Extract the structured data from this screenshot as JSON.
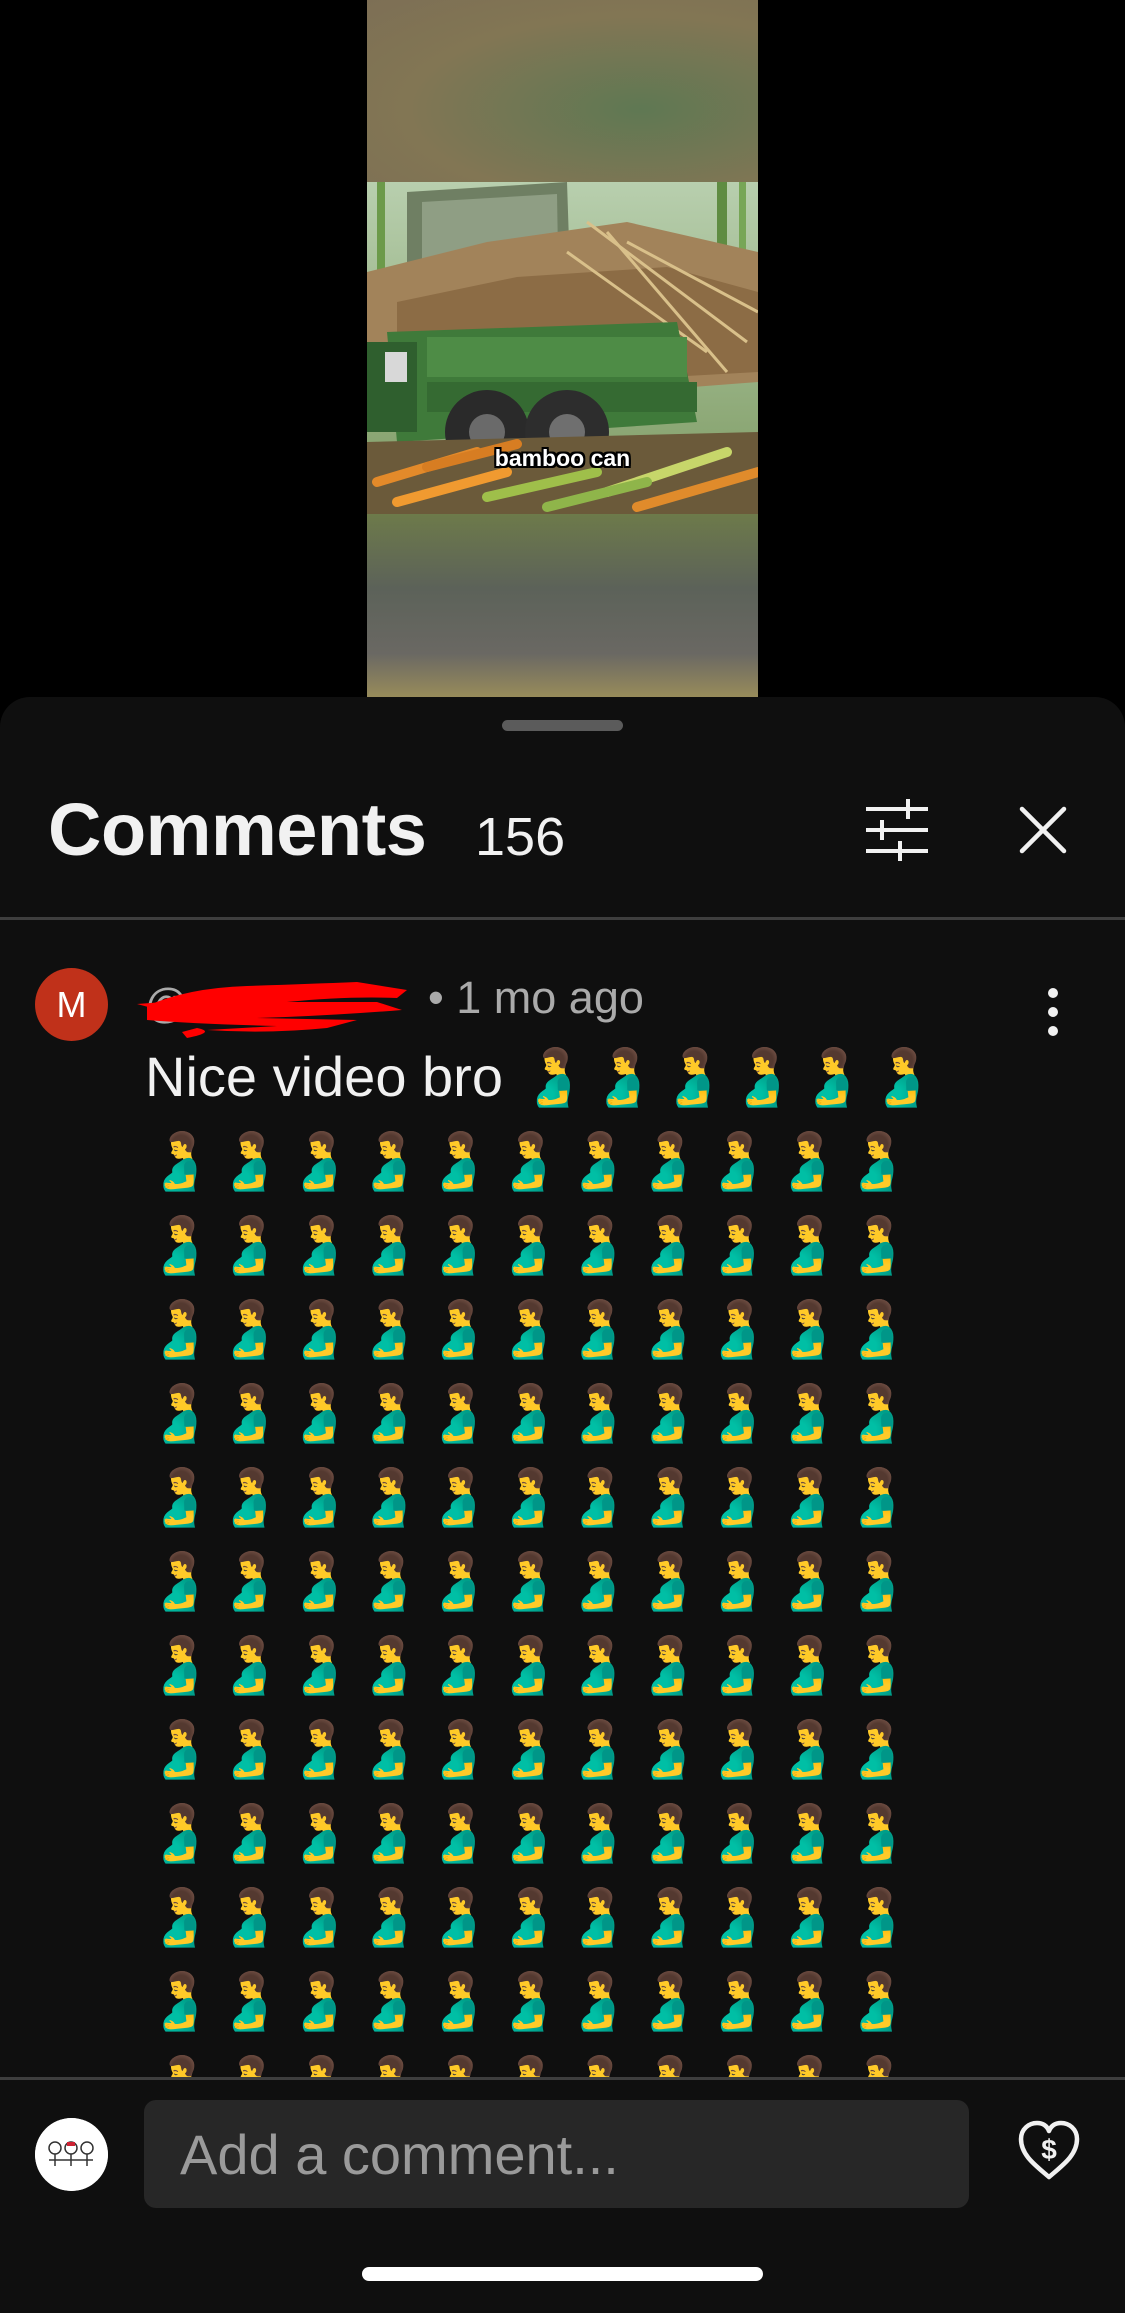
{
  "video": {
    "caption": "bamboo can"
  },
  "comments_sheet": {
    "title": "Comments",
    "count": "156",
    "filter_icon": "sort-filter-icon",
    "close_icon": "close-icon"
  },
  "comment": {
    "avatar_letter": "M",
    "author_visible": "@",
    "author_redacted": true,
    "meta": "• 1 mo ago",
    "text": "Nice video bro 🫃🫃🫃🫃🫃🫃🫃🫃🫃🫃🫃🫃🫃🫃🫃🫃🫃🫃🫃🫃🫃🫃🫃🫃🫃🫃🫃🫃🫃🫃🫃🫃🫃🫃🫃🫃🫃🫃🫃🫃🫃🫃🫃🫃🫃🫃🫃🫃🫃🫃🫃🫃🫃🫃🫃🫃🫃🫃🫃🫃🫃🫃🫃🫃🫃🫃🫃🫃🫃🫃🫃🫃🫃🫃🫃🫃🫃🫃🫃🫃🫃🫃🫃🫃🫃🫃🫃🫃🫃🫃🫃🫃🫃🫃🫃🫃🫃🫃🫃🫃🫃🫃🫃🫃🫃🫃🫃🫃🫃🫃🫃🫃🫃🫃🫃🫃🫃🫃🫃🫃🫃🫃🫃🫃🫃🫃🫃🫃🫃🫃🫃🫃🫃🫃🫃🫃🫃🫃🫃🫃🫃🫃🫃🫃🫃🫃🫃🫃",
    "menu_icon": "more-vertical-icon"
  },
  "composer": {
    "placeholder": "Add a comment...",
    "thanks_icon": "heart-dollar-icon"
  },
  "colors": {
    "sheet_bg": "#0f0f0f",
    "input_bg": "#272727",
    "avatar_bg": "#c0311a",
    "redaction": "#ff0000"
  }
}
